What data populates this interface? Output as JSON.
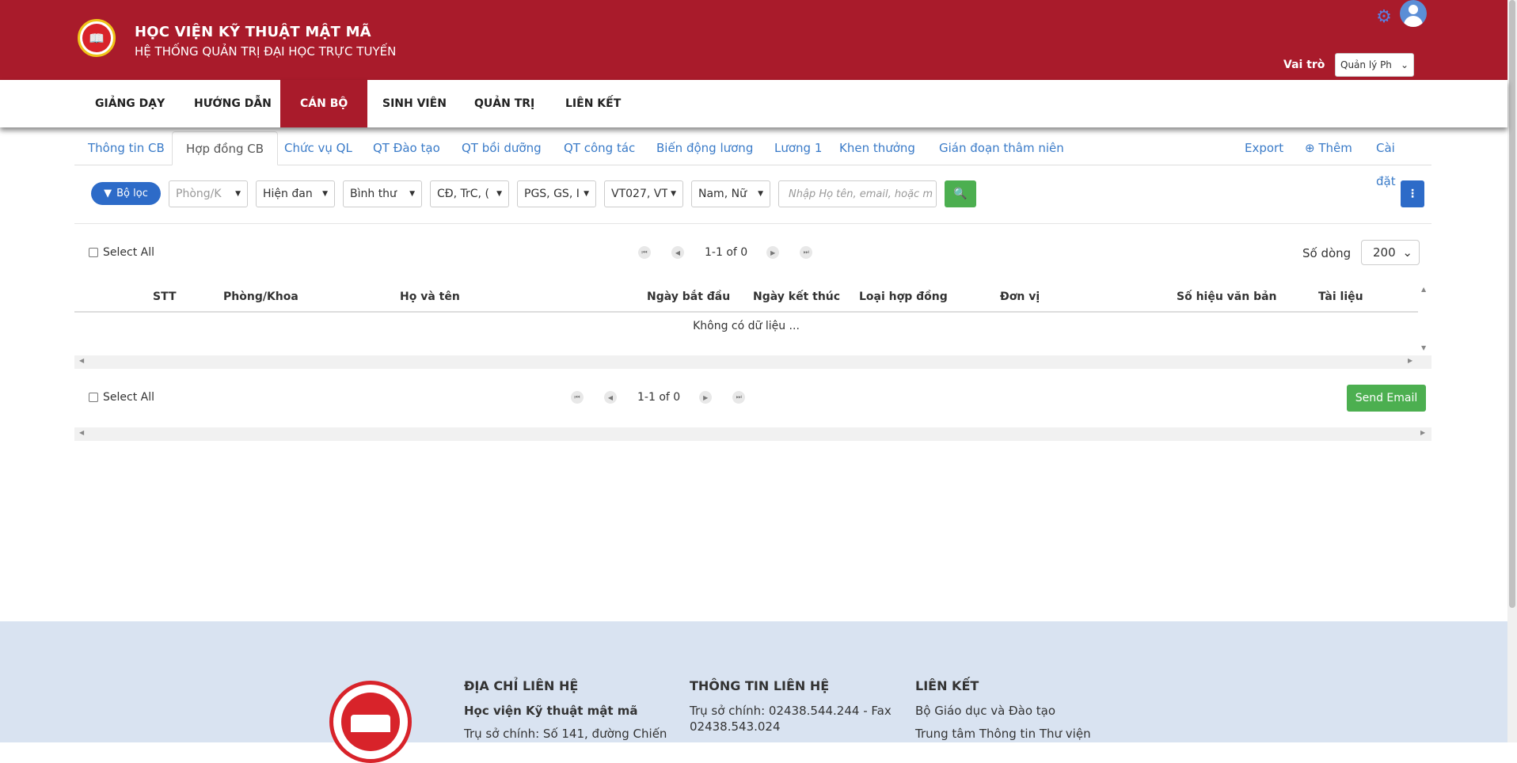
{
  "header": {
    "title": "HỌC VIỆN KỸ THUẬT MẬT MÃ",
    "subtitle": "HỆ THỐNG QUẢN TRỊ ĐẠI HỌC TRỰC TUYẾN",
    "role_label": "Vai trò",
    "role_value": "Quản lý Ph"
  },
  "nav": [
    "GIẢNG DẠY",
    "HƯỚNG DẪN",
    "CÁN BỘ",
    "SINH VIÊN",
    "QUẢN TRỊ",
    "LIÊN KẾT"
  ],
  "subtabs": [
    "Thông tin CB",
    "Hợp đồng CB",
    "Chức vụ QL",
    "QT Đào tạo",
    "QT bồi dưỡng",
    "QT công tác",
    "Biến động lương",
    "Lương 1",
    "Khen thưởng",
    "Gián đoạn thâm niên"
  ],
  "subtabs_right": [
    "Export",
    "Thêm",
    "Cài đặt"
  ],
  "filters": {
    "button": "Bộ lọc",
    "dropdowns": [
      "Phòng/K",
      "Hiện đan",
      "Bình thư",
      "CĐ, TrC, (",
      "PGS, GS, I",
      "VT027, VT",
      "Nam, Nữ"
    ],
    "search_placeholder": "Nhập Họ tên, email, hoặc m"
  },
  "table": {
    "select_all": "Select All",
    "pager_text": "1-1 of 0",
    "rows_label": "Số dòng",
    "rows_value": "200",
    "columns": [
      "STT",
      "Phòng/Khoa",
      "Họ và tên",
      "Ngày bắt đầu",
      "Ngày kết thúc",
      "Loại hợp đồng",
      "Đơn vị",
      "Số hiệu văn bản",
      "Tài liệu"
    ],
    "empty": "Không có dữ liệu ...",
    "send_email": "Send Email"
  },
  "footer": {
    "col1_title": "ĐỊA CHỈ LIÊN HỆ",
    "col1_line1": "Học viện Kỹ thuật mật mã",
    "col1_line2": "Trụ sở chính: Số 141, đường Chiến",
    "col2_title": "THÔNG TIN LIÊN HỆ",
    "col2_line1": "Trụ sở chính: 02438.544.244 - Fax",
    "col2_line2": "02438.543.024",
    "col3_title": "LIÊN KẾT",
    "col3_line1": "Bộ Giáo dục và Đào tạo",
    "col3_line2": "Trung tâm Thông tin Thư viện"
  },
  "colors": {
    "brand_red": "#a91b2b",
    "link_blue": "#3a7bc8",
    "primary_blue": "#2d6bc8",
    "success_green": "#4caf50",
    "footer_bg": "#d9e3f1"
  }
}
